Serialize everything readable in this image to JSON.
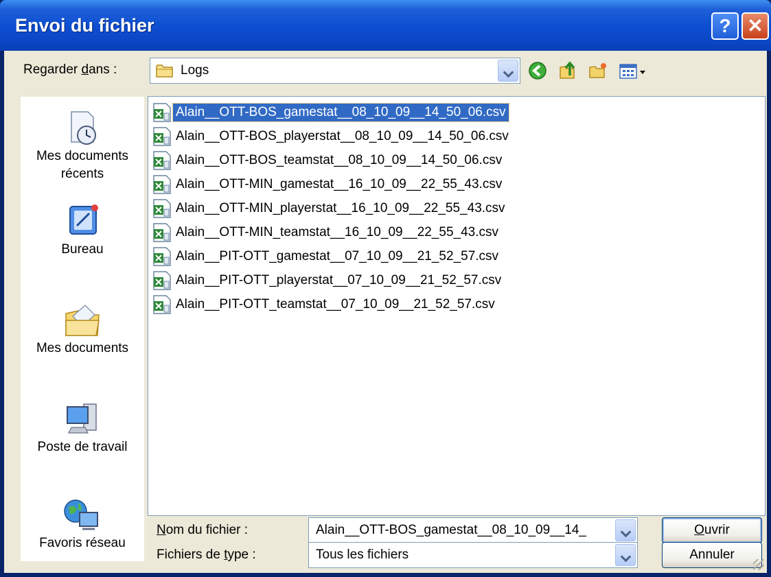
{
  "window": {
    "title": "Envoi du fichier",
    "help_label": "?",
    "close_label": "✕"
  },
  "look_in": {
    "label_before": "Regarder ",
    "label_accel": "d",
    "label_after": "ans :",
    "value": "Logs"
  },
  "toolbar": {
    "icons": [
      "back-icon",
      "up-folder-icon",
      "new-folder-icon",
      "view-menu-icon"
    ]
  },
  "places": [
    {
      "label": "Mes documents récents",
      "icon": "recent-documents-icon"
    },
    {
      "label": "Bureau",
      "icon": "desktop-icon"
    },
    {
      "label": "Mes documents",
      "icon": "my-documents-icon"
    },
    {
      "label": "Poste de travail",
      "icon": "my-computer-icon"
    },
    {
      "label": "Favoris réseau",
      "icon": "network-places-icon"
    }
  ],
  "files": [
    "Alain__OTT-BOS_gamestat__08_10_09__14_50_06.csv",
    "Alain__OTT-BOS_playerstat__08_10_09__14_50_06.csv",
    "Alain__OTT-BOS_teamstat__08_10_09__14_50_06.csv",
    "Alain__OTT-MIN_gamestat__16_10_09__22_55_43.csv",
    "Alain__OTT-MIN_playerstat__16_10_09__22_55_43.csv",
    "Alain__OTT-MIN_teamstat__16_10_09__22_55_43.csv",
    "Alain__PIT-OTT_gamestat__07_10_09__21_52_57.csv",
    "Alain__PIT-OTT_playerstat__07_10_09__21_52_57.csv",
    "Alain__PIT-OTT_teamstat__07_10_09__21_52_57.csv"
  ],
  "selected_file_index": 0,
  "filename": {
    "label_accel": "N",
    "label_rest": "om du fichier :",
    "value": "Alain__OTT-BOS_gamestat__08_10_09__14_"
  },
  "filetype": {
    "label_before": "Fichiers de ",
    "label_accel": "t",
    "label_after": "ype :",
    "value": "Tous les fichiers"
  },
  "buttons": {
    "open_accel": "O",
    "open_rest": "uvrir",
    "cancel": "Annuler"
  }
}
